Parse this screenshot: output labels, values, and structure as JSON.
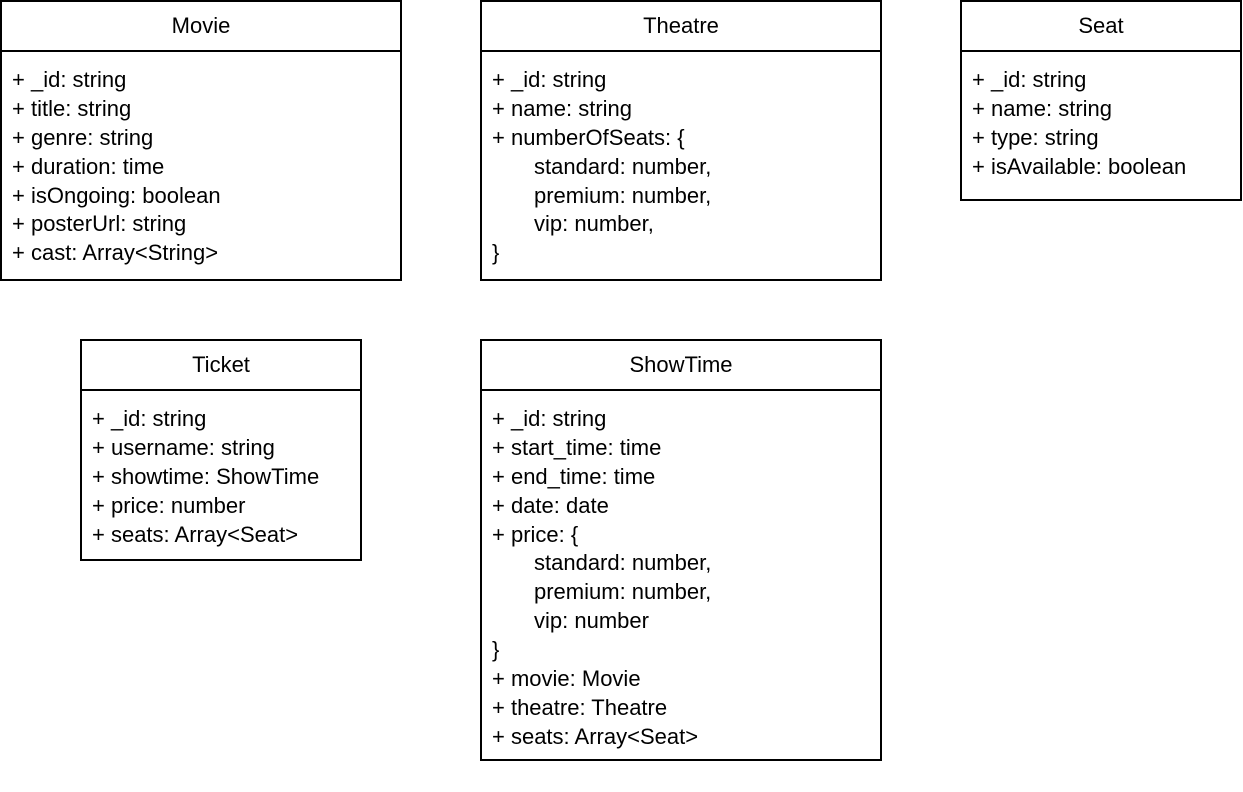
{
  "classes": {
    "movie": {
      "name": "Movie",
      "attributes": [
        "+ _id: string",
        "+ title: string",
        "+ genre: string",
        "+ duration: time",
        "+ isOngoing: boolean",
        "+ posterUrl: string",
        "+ cast: Array<String>"
      ]
    },
    "theatre": {
      "name": "Theatre",
      "attributes": [
        "+ _id: string",
        "+ name: string",
        "+ numberOfSeats: {",
        "standard: number,",
        "premium: number,",
        "vip: number,",
        "}"
      ]
    },
    "seat": {
      "name": "Seat",
      "attributes": [
        "+ _id: string",
        "+ name: string",
        "+ type: string",
        "+ isAvailable: boolean"
      ]
    },
    "ticket": {
      "name": "Ticket",
      "attributes": [
        "+ _id: string",
        "+ username: string",
        "+ showtime: ShowTime",
        "+ price: number",
        "+ seats: Array<Seat>"
      ]
    },
    "showtime": {
      "name": "ShowTime",
      "attributes": [
        "+ _id: string",
        "+ start_time: time",
        "+ end_time: time",
        "+ date: date",
        "+ price: {",
        "standard: number,",
        "premium: number,",
        "vip: number",
        "}",
        "+ movie: Movie",
        "+ theatre: Theatre",
        "+ seats: Array<Seat>"
      ]
    }
  }
}
